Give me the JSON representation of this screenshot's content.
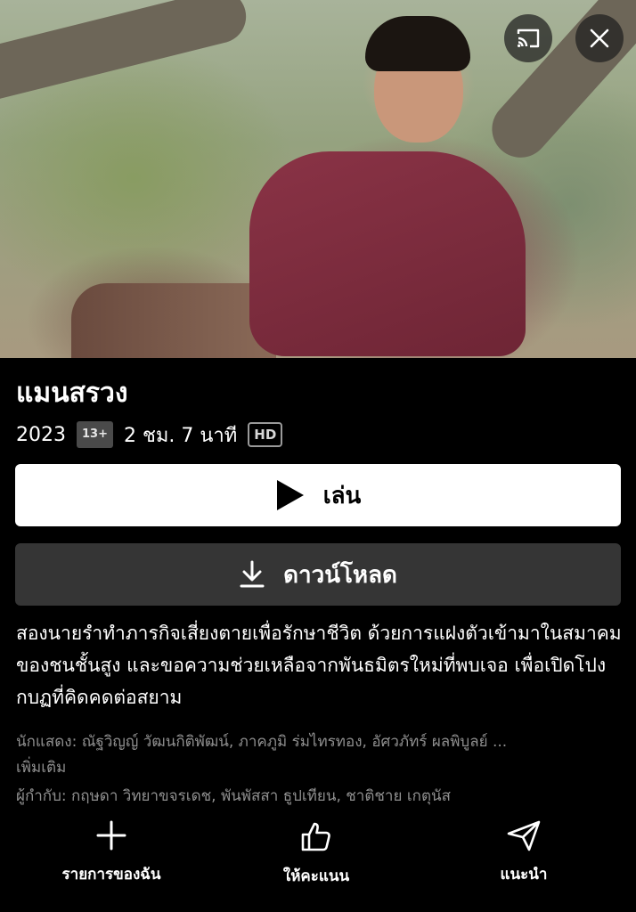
{
  "hero": {
    "cast_icon": "cast-icon",
    "close_icon": "close-icon"
  },
  "title": "แมนสรวง",
  "meta": {
    "year": "2023",
    "rating": "13+",
    "duration": "2 ชม. 7 นาที",
    "quality": "HD"
  },
  "buttons": {
    "play_label": "เล่น",
    "play_icon": "play-icon",
    "download_label": "ดาวน์โหลด",
    "download_icon": "download-icon"
  },
  "synopsis": "สองนายรำทำภารกิจเสี่ยงตายเพื่อรักษาชีวิต ด้วยการแฝงตัวเข้ามาในสมาคมของชนชั้นสูง และขอความช่วยเหลือจากพันธมิตรใหม่ที่พบเจอ เพื่อเปิดโปงกบฏที่คิดคดต่อสยาม",
  "credits": {
    "cast": "นักแสดง: ณัฐวิญญ์ วัฒนกิติพัฒน์, ภาคภูมิ ร่มไทรทอง, อัศวภัทร์ ผลพิบูลย์ ...",
    "more": "เพิ่มเติม",
    "director": "ผู้กำกับ: กฤษดา วิทยาขจรเดช, พันพัสสา ธูปเทียน, ชาติชาย เกตุนัส"
  },
  "actions": [
    {
      "label": "รายการของฉัน",
      "icon": "plus-icon"
    },
    {
      "label": "ให้คะแนน",
      "icon": "thumbs-up-icon"
    },
    {
      "label": "แนะนำ",
      "icon": "send-icon"
    }
  ],
  "colors": {
    "background": "#000000",
    "play_button": "#ffffff",
    "download_button": "#353535",
    "muted_text": "#8f8f8f"
  }
}
